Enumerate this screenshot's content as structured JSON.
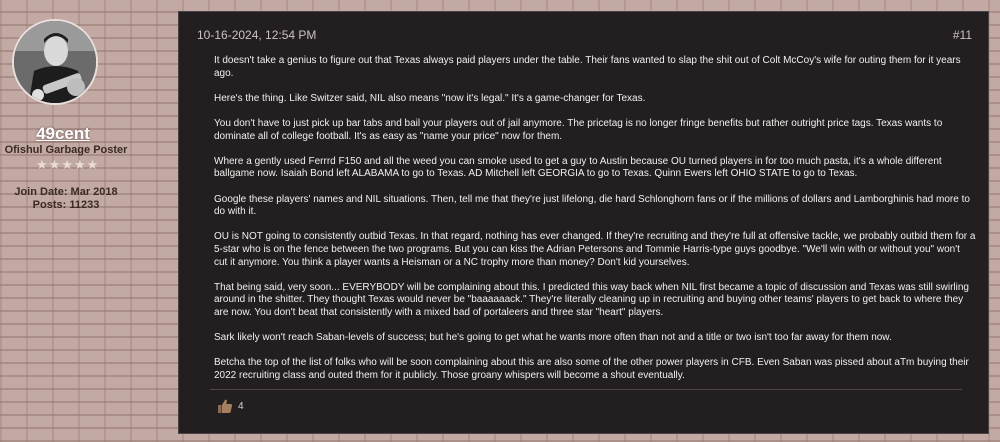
{
  "user": {
    "username": "49cent",
    "title": "Ofishul Garbage Poster",
    "stars": [
      "★",
      "★",
      "★",
      "★",
      "★"
    ],
    "join_date": "Join Date: Mar 2018",
    "posts": "Posts: 11233"
  },
  "post": {
    "date": "10-16-2024, 12:54 PM",
    "number": "#11",
    "paragraphs": [
      "It doesn't take a genius to figure out that Texas always paid players under the table. Their fans wanted to slap the shit out of Colt McCoy's wife for outing them for it years ago.",
      "Here's the thing. Like Switzer said, NIL also means \"now it's legal.\" It's a game-changer for Texas.",
      "You don't have to just pick up bar tabs and bail your players out of jail anymore. The pricetag is no longer fringe benefits but rather outright price tags. Texas wants to dominate all of college football. It's as easy as \"name your price\" now for them.",
      "Where a gently used Ferrrd F150 and all the weed you can smoke used to get a guy to Austin because OU turned players in for too much pasta, it's a whole different ballgame now. Isaiah Bond left ALABAMA to go to Texas. AD Mitchell left GEORGIA to go to Texas. Quinn Ewers left OHIO STATE to go to Texas.",
      "Google these players' names and NIL situations. Then, tell me that they're just lifelong, die hard Schlonghorn fans or if the millions of dollars and Lamborghinis had more to do with it.",
      "OU is NOT going to consistently outbid Texas. In that regard, nothing has ever changed. If they're recruiting and they're full at offensive tackle, we probably outbid them for a 5-star who is on the fence between the two programs. But you can kiss the Adrian Petersons and Tommie Harris-type guys goodbye. \"We'll win with or without you\" won't cut it anymore. You think a player wants a Heisman or a NC trophy more than money? Don't kid yourselves.",
      "That being said, very soon... EVERYBODY will be complaining about this. I predicted this way back when NIL first became a topic of discussion and Texas was still swirling around in the shitter. They thought Texas would never be \"baaaaaack.\" They're literally cleaning up in recruiting and buying other teams' players to get back to where they are now. You don't beat that consistently with a mixed bad of portaleers and three star \"heart\" players.",
      "Sark likely won't reach Saban-levels of success; but he's going to get what he wants more often than not and a title or two isn't too far away for them now.",
      "Betcha the top of the list of folks who will be soon complaining about this are also some of the other power players in CFB. Even Saban was pissed about aTm buying their 2022 recruiting class and outed them for it publicly. Those groany whispers will become a shout eventually."
    ],
    "likes": "4",
    "like_icon": "thumbs-up-icon"
  },
  "colors": {
    "background": "#c3a9a3",
    "post_background": "#231f20",
    "text": "#f2f0ee"
  }
}
